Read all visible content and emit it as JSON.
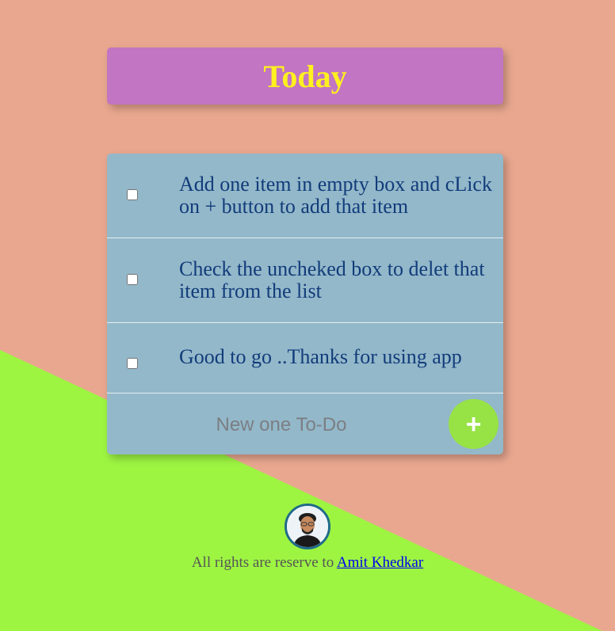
{
  "header": {
    "title": "Today"
  },
  "todo_list": {
    "items": [
      {
        "text": "Add one item in empty box and cLick on + button to add that item",
        "checked": false
      },
      {
        "text": "Check the uncheked box to delet that item from the list",
        "checked": false
      },
      {
        "text": "Good to go ..Thanks for using app",
        "checked": false
      }
    ],
    "new_item": {
      "placeholder": "New one To-Do",
      "value": ""
    },
    "add_button_label": "+"
  },
  "footer": {
    "prefix": "All rights are reserve to ",
    "link_text": "Amit Khedkar"
  },
  "colors": {
    "background": "#E9A78F",
    "triangle": "#9DF542",
    "header_bg": "#C275C2",
    "header_text": "#FFF01F",
    "list_bg": "#93B8CA",
    "item_text": "#123C7A",
    "add_button": "#97E245"
  },
  "icons": {
    "avatar": "profile-avatar-icon",
    "add": "plus-icon"
  }
}
